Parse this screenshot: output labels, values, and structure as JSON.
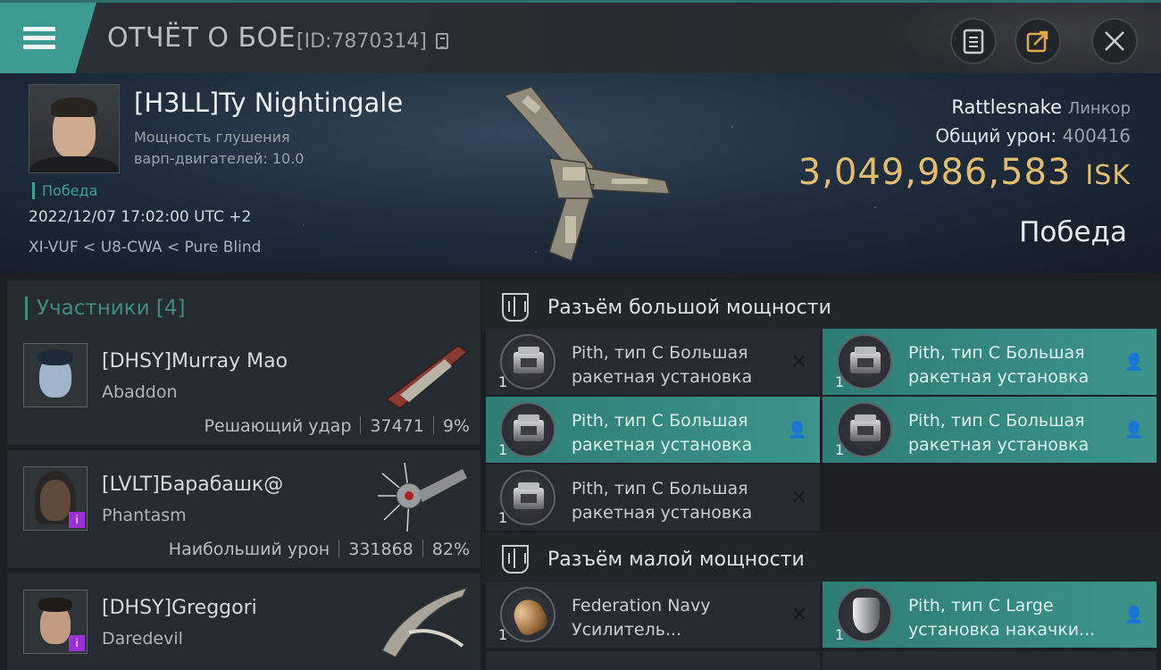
{
  "header": {
    "title": "ОТЧЁТ О БОЕ",
    "report_id": "[ID:7870314]"
  },
  "victim": {
    "name": "[H3LL]Ty Nightingale",
    "attribute_line1": "Мощность глушения",
    "attribute_line2": "варп-двигателей: 10.0",
    "result_small": "Победа",
    "datetime": "2022/12/07 17:02:00 UTC +2",
    "location": "XI-VUF < U8-CWA < Pure Blind",
    "ship_name": "Rattlesnake",
    "ship_class": "Линкор",
    "total_damage_label": "Общий урон:",
    "total_damage": "400416",
    "isk_value": "3,049,986,583",
    "isk_unit": "ISK",
    "result": "Победа"
  },
  "participants": {
    "title": "Участники [4]",
    "rows": [
      {
        "name": "[DHSY]Murray Mao",
        "ship": "Abaddon",
        "role": "Решающий удар",
        "damage": "37471",
        "percent": "9%"
      },
      {
        "name": "[LVLT]Барабашк@",
        "ship": "Phantasm",
        "role": "Наибольший урон",
        "damage": "331868",
        "percent": "82%"
      },
      {
        "name": "[DHSY]Greggori",
        "ship": "Daredevil"
      }
    ]
  },
  "fitting": {
    "high_slots": {
      "title": "Разъём большой мощности",
      "modules": [
        {
          "qty": "1",
          "name": "Pith, тип C Большая\nракетная установка",
          "state": "destroyed",
          "highlight": false
        },
        {
          "qty": "1",
          "name": "Pith, тип C Большая\nракетная установка",
          "state": "dropped",
          "highlight": true
        },
        {
          "qty": "1",
          "name": "Pith, тип C Большая\nракетная установка",
          "state": "dropped",
          "highlight": true
        },
        {
          "qty": "1",
          "name": "Pith, тип C Большая\nракетная установка",
          "state": "dropped",
          "highlight": true
        },
        {
          "qty": "1",
          "name": "Pith, тип C Большая\nракетная установка",
          "state": "destroyed",
          "highlight": false
        }
      ]
    },
    "low_slots": {
      "title": "Разъём малой мощности",
      "modules": [
        {
          "qty": "1",
          "name": "Federation Navy\nУсилитель...",
          "state": "destroyed",
          "highlight": false
        },
        {
          "qty": "1",
          "name": "Pith, тип C Large\nустановка накачки...",
          "state": "dropped",
          "highlight": true
        }
      ]
    }
  },
  "colors": {
    "accent": "#3d9b93",
    "isk": "#e2bd6f",
    "module_highlight": "#3c938a"
  },
  "icons": {
    "menu": "hamburger-icon",
    "copy": "copy-icon",
    "report": "clipboard-icon",
    "share": "share-icon",
    "close": "close-icon",
    "destroyed": "x-mark-icon",
    "dropped": "person-icon",
    "slot": "high-slot-icon"
  }
}
